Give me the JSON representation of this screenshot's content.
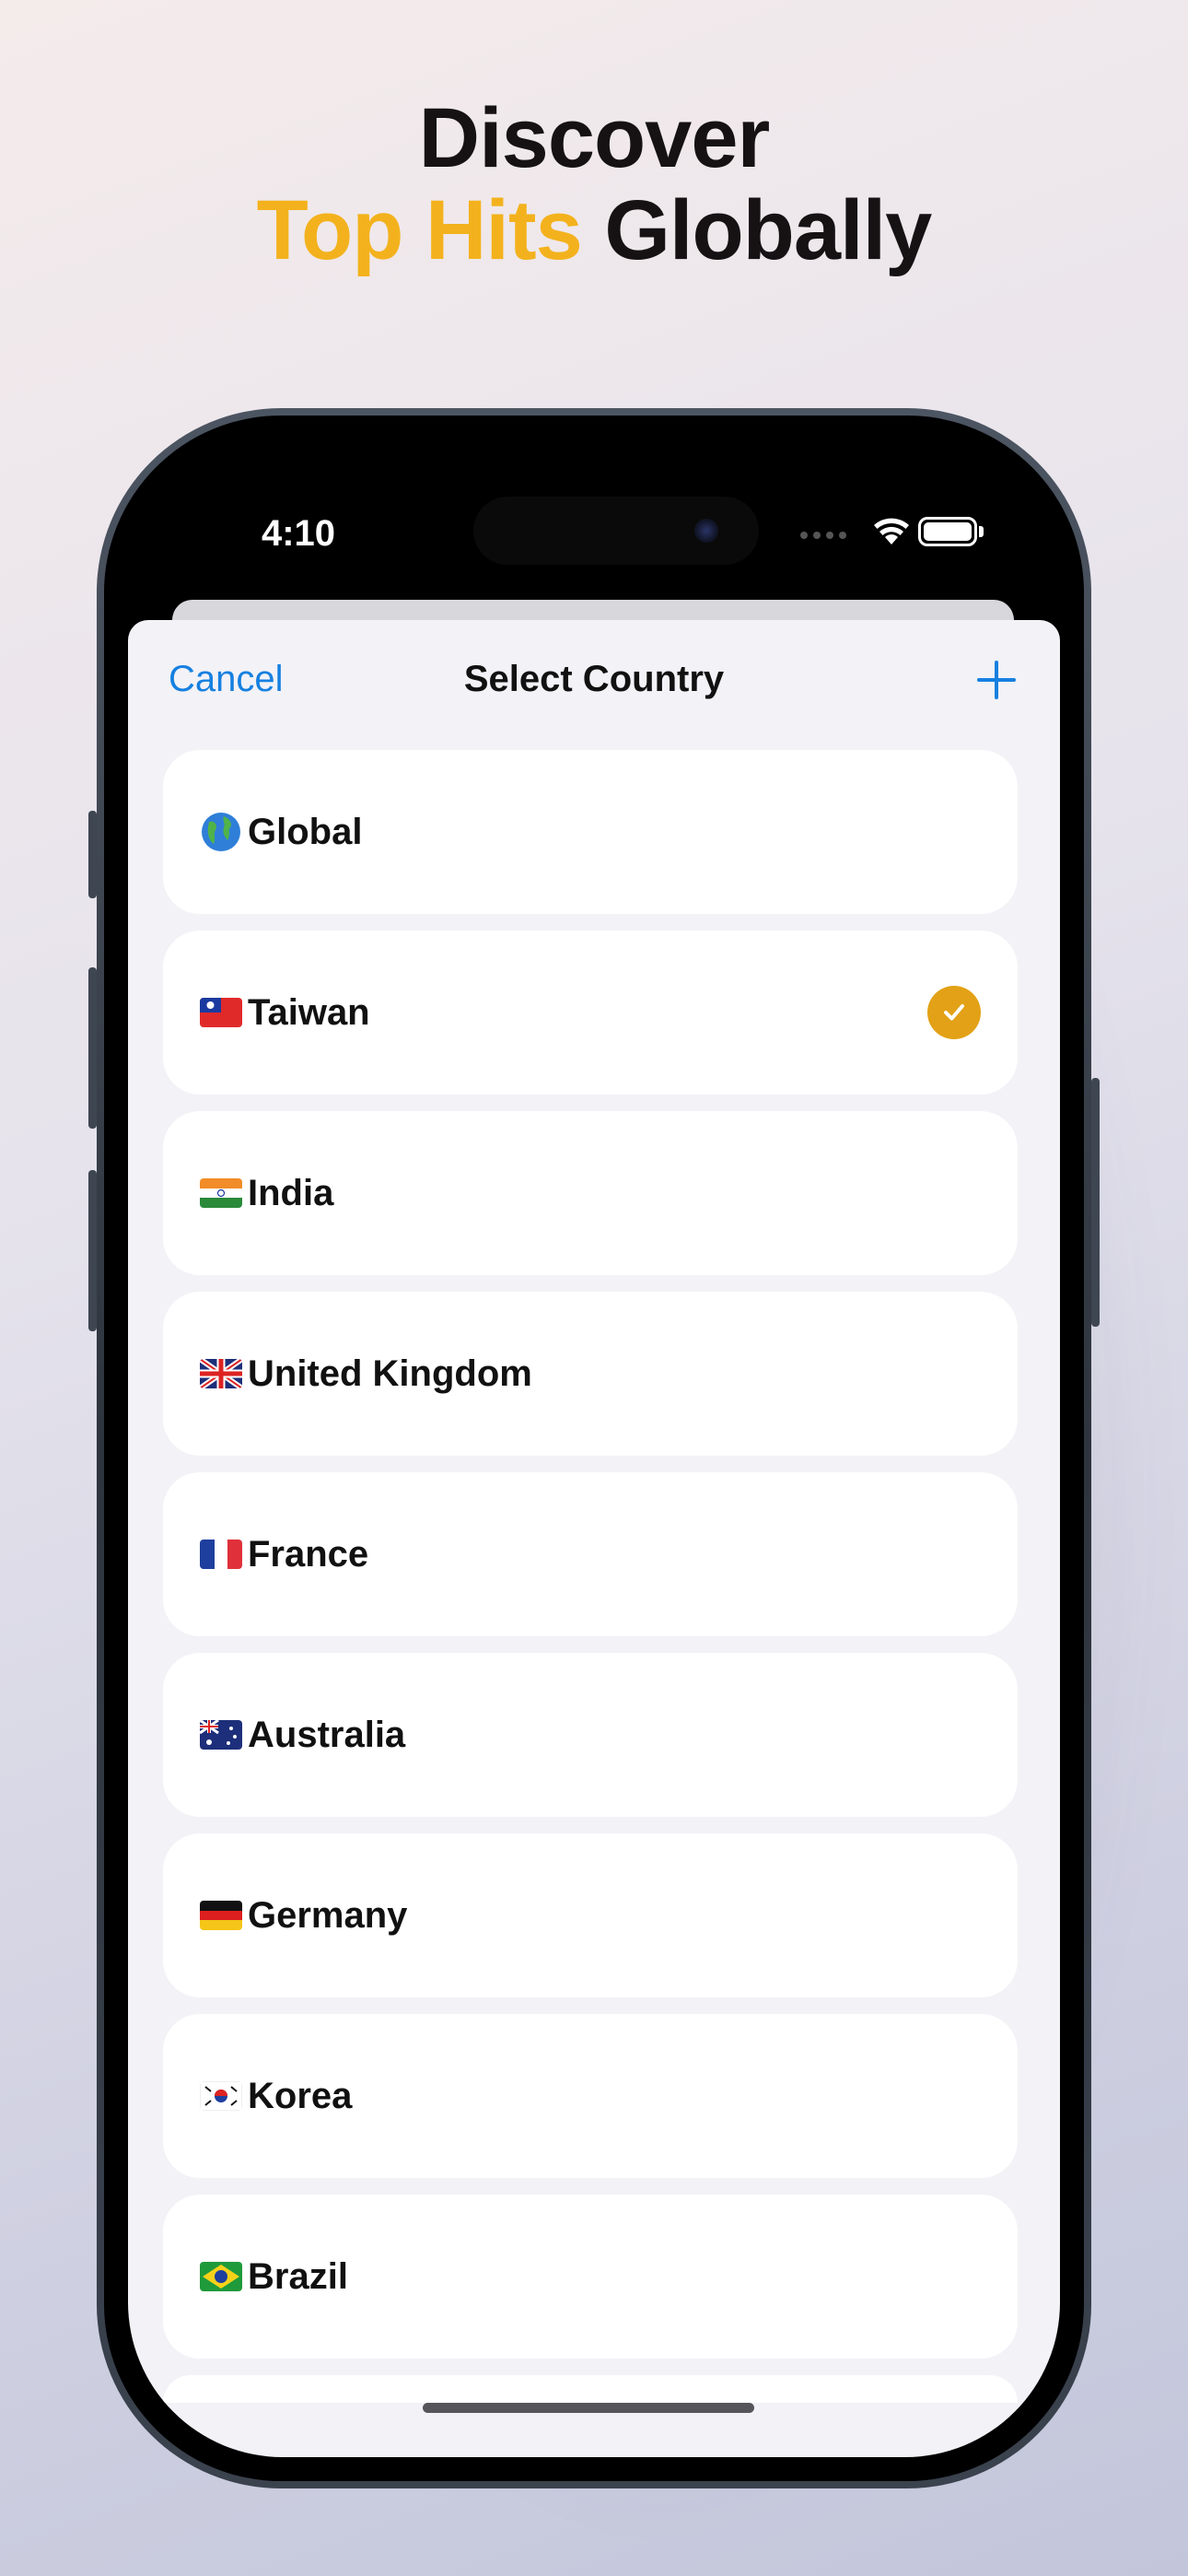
{
  "headline": {
    "line1": "Discover",
    "accent": "Top Hits",
    "rest": "Globally"
  },
  "status_bar": {
    "time": "4:10"
  },
  "nav": {
    "cancel_label": "Cancel",
    "title": "Select Country",
    "add_icon": "plus-icon"
  },
  "countries": [
    {
      "name": "Global",
      "flag": "globe",
      "selected": false
    },
    {
      "name": "Taiwan",
      "flag": "tw",
      "selected": true
    },
    {
      "name": "India",
      "flag": "in",
      "selected": false
    },
    {
      "name": "United Kingdom",
      "flag": "gb",
      "selected": false
    },
    {
      "name": "France",
      "flag": "fr",
      "selected": false
    },
    {
      "name": "Australia",
      "flag": "au",
      "selected": false
    },
    {
      "name": "Germany",
      "flag": "de",
      "selected": false
    },
    {
      "name": "Korea",
      "flag": "kr",
      "selected": false
    },
    {
      "name": "Brazil",
      "flag": "br",
      "selected": false
    }
  ],
  "colors": {
    "accent": "#f3b21d",
    "check": "#e2a116",
    "link": "#1680e0"
  }
}
